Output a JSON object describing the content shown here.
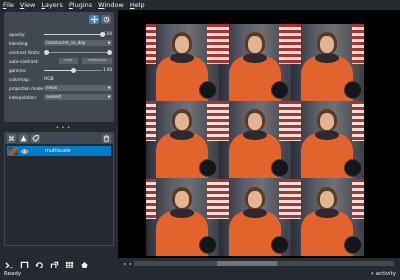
{
  "menu": [
    "File",
    "View",
    "Layers",
    "Plugins",
    "Window",
    "Help"
  ],
  "layer_controls": {
    "opacity": {
      "label": "opacity:",
      "value": "1.00",
      "fraction": 1.0
    },
    "blending": {
      "label": "blending:",
      "value": "translucent_no_dep"
    },
    "contrast_limits": {
      "label": "contrast limits:"
    },
    "auto_contrast": {
      "label": "auto-contrast:",
      "once": "once",
      "continuous": "continuous"
    },
    "gamma": {
      "label": "gamma:",
      "value": "1.00",
      "fraction": 0.5
    },
    "colormap": {
      "label": "colormap:",
      "value": "RGB"
    },
    "projection_mode": {
      "label": "projection mode:",
      "value": "mean"
    },
    "interpolation": {
      "label": "interpolation:",
      "value": "nearest"
    }
  },
  "layers": [
    {
      "name": "multiscale",
      "visible": true,
      "selected": true
    }
  ],
  "colors": {
    "accent": "#007acc",
    "panel": "#414851",
    "background": "#262930"
  },
  "status": {
    "left": "Ready",
    "right": "• activity"
  }
}
